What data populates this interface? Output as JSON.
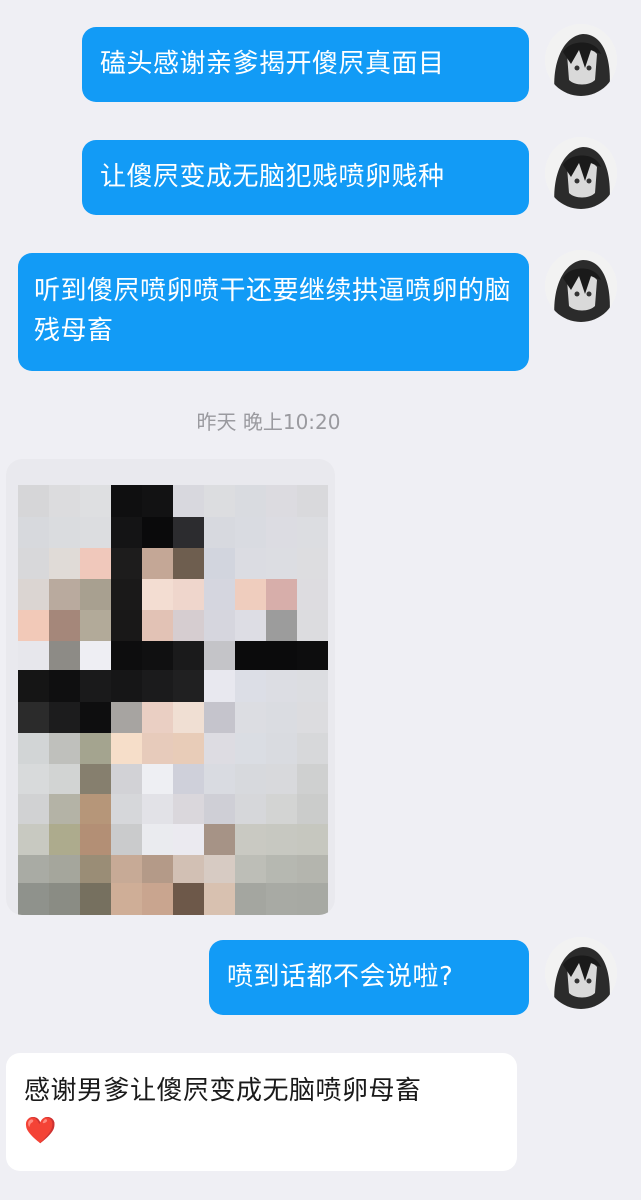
{
  "messages": [
    {
      "id": "m1",
      "direction": "outgoing",
      "text": "磕头感谢亲爹揭开傻屄真面目"
    },
    {
      "id": "m2",
      "direction": "outgoing",
      "text": "让傻屄变成无脑犯贱喷卵贱种"
    },
    {
      "id": "m3",
      "direction": "outgoing",
      "text": "听到傻屄喷卵喷干还要继续拱逼喷卵的脑残母畜"
    },
    {
      "id": "m4",
      "direction": "outgoing",
      "text": "喷到话都不会说啦?"
    },
    {
      "id": "m5",
      "direction": "incoming",
      "text": "感谢男爹让傻屄变成无脑喷卵母畜",
      "emoji": "❤️"
    }
  ],
  "timestamp": "昨天 晚上10:20",
  "image_message": {
    "pixelated": true
  },
  "colors": {
    "background": "#efeff4",
    "outgoing_bubble": "#129bf6",
    "incoming_bubble": "#ffffff",
    "timestamp_text": "#9a9a9f"
  },
  "icons": [
    "avatar",
    "heart-emoji"
  ]
}
